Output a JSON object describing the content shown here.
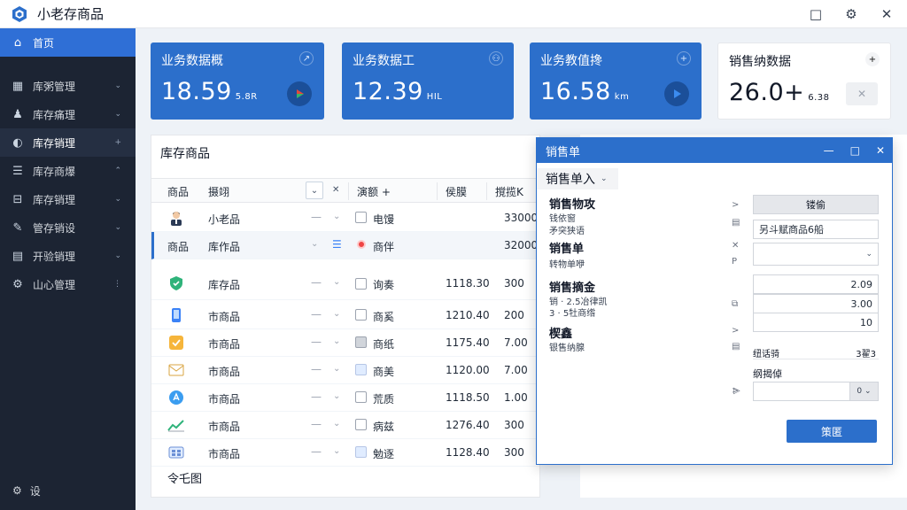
{
  "app": {
    "title": "小老存商品"
  },
  "window_controls": [
    "□",
    "⚙",
    "✕"
  ],
  "sidebar": {
    "items": [
      {
        "label": "首页",
        "icon": "⌂",
        "caret": ""
      },
      {
        "label": "库粥管理",
        "icon": "▦",
        "caret": "⌄"
      },
      {
        "label": "库存痛理",
        "icon": "♟",
        "caret": "⌄"
      },
      {
        "label": "库存销理",
        "icon": "◐",
        "caret": "+"
      },
      {
        "label": "库存商爆",
        "icon": "☰",
        "caret": "⌃"
      },
      {
        "label": "库存销理",
        "icon": "⊟",
        "caret": "⌄"
      },
      {
        "label": "管存销设",
        "icon": "✎",
        "caret": "⌄"
      },
      {
        "label": "开验销理",
        "icon": "▤",
        "caret": "⌄"
      },
      {
        "label": "山心管理",
        "icon": "⚙",
        "caret": "⋮"
      }
    ],
    "footer": {
      "label": "设",
      "icon": "⚙"
    }
  },
  "kpis": [
    {
      "title": "业务数据概",
      "value": "18.59",
      "unit": "5.8R",
      "corner": "↗"
    },
    {
      "title": "业务数据工",
      "value": "12.39",
      "unit": "HIL",
      "corner": "⚇"
    },
    {
      "title": "业务教值搀",
      "value": "16.58",
      "unit": "km",
      "corner": "+"
    },
    {
      "title": "销售纳数据",
      "value": "26.0+",
      "unit": "6.38",
      "corner": "+"
    }
  ],
  "panel": {
    "title": "库存商品",
    "headers": {
      "c1": "商品",
      "c2": "摄翊",
      "c3": "⌄",
      "c4": "✕",
      "c5": "演额 +",
      "c6": "侯膜",
      "c7": "撹揽K"
    },
    "rows": [
      {
        "name": "小老品",
        "status": "电馒",
        "num": "",
        "amt": "33000"
      },
      {
        "name": "库作品",
        "status": "商伴",
        "num": "",
        "amt": "32000",
        "label_left": "商品"
      },
      {
        "name": "库存品",
        "status": "询奏",
        "num": "1118.30",
        "amt": "300"
      },
      {
        "name": "市商品",
        "status": "商奚",
        "num": "1210.40",
        "amt": "200"
      },
      {
        "name": "市商品",
        "status": "商纸",
        "num": "1175.40",
        "amt": "7.00"
      },
      {
        "name": "市商品",
        "status": "商美",
        "num": "1120.00",
        "amt": "7.00"
      },
      {
        "name": "市商品",
        "status": "荒质",
        "num": "1118.50",
        "amt": "1.00"
      },
      {
        "name": "市商品",
        "status": "病兹",
        "num": "1276.40",
        "amt": "300"
      },
      {
        "name": "市商品",
        "status": "勉逐",
        "num": "1128.40",
        "amt": "300"
      }
    ],
    "footer": "令乇图"
  },
  "dialog": {
    "title": "销售单",
    "sub": "销售单入",
    "controls": [
      "—",
      "□",
      "✕"
    ],
    "top_button": "镂偷",
    "sections": [
      {
        "label": "销售物攻",
        "small1": "钱依窗",
        "small2": "矛突狭语"
      },
      {
        "label": "销售单",
        "small1": "转物单咿"
      },
      {
        "label": "销售摘金",
        "small1": "销 · 2.5冶律凯",
        "small2": "3 · 5牡商绺"
      },
      {
        "label": "楔鑫",
        "small1": "银售纳腺"
      }
    ],
    "field_1": "另斗赋商品6船",
    "field_vals": [
      "2.09",
      "3.00",
      "10"
    ],
    "inline_left": "纽话骑",
    "inline_right": "3翟3",
    "label_extra": "纲揭倬",
    "addon": "0 ⌄",
    "submit": "策匿"
  }
}
